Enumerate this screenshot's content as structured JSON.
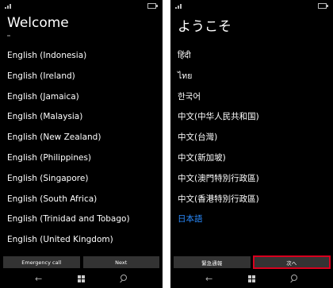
{
  "left_screen": {
    "title": "Welcome",
    "languages": [
      "English (Indonesia)",
      "English (Ireland)",
      "English (Jamaica)",
      "English (Malaysia)",
      "English (New Zealand)",
      "English (Philippines)",
      "English (Singapore)",
      "English (South Africa)",
      "English (Trinidad and Tobago)",
      "English (United Kingdom)"
    ],
    "emergency_label": "Emergency call",
    "next_label": "Next"
  },
  "right_screen": {
    "title": "ようこそ",
    "languages": [
      "हिंदी",
      "ไทย",
      "한국어",
      "中文(中华人民共和国)",
      "中文(台灣)",
      "中文(新加坡)",
      "中文(澳門特別行政區)",
      "中文(香港特別行政區)",
      "日本語"
    ],
    "selected_language": "日本語",
    "emergency_label": "緊急通報",
    "next_label": "次へ"
  },
  "nav": {
    "back_icon": "←"
  },
  "colors": {
    "selected": "#2a8cff",
    "highlight_border": "#d8001e"
  },
  "icons": [
    "signal-icon",
    "battery-icon",
    "back-arrow-icon",
    "windows-start-icon",
    "search-icon"
  ]
}
